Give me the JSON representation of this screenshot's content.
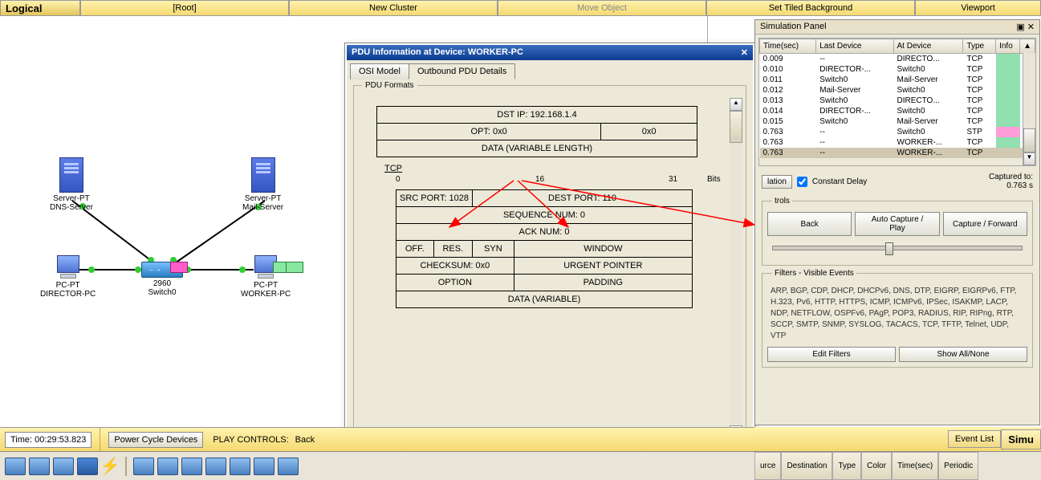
{
  "topbar": {
    "logical": "Logical",
    "root": "[Root]",
    "newCluster": "New Cluster",
    "moveObject": "Move Object",
    "tiledBg": "Set Tiled Background",
    "viewport": "Viewport"
  },
  "devices": {
    "dns": {
      "type": "Server-PT",
      "name": "DNS-Server"
    },
    "mail": {
      "type": "Server-PT",
      "name": "Mail-Server"
    },
    "director": {
      "type": "PC-PT",
      "name": "DIRECTOR-PC"
    },
    "worker": {
      "type": "PC-PT",
      "name": "WORKER-PC"
    },
    "switch": {
      "type": "2960",
      "name": "Switch0"
    }
  },
  "pdu": {
    "title": "PDU Information at Device: WORKER-PC",
    "tabs": {
      "osi": "OSI Model",
      "outbound": "Outbound PDU Details"
    },
    "formats": "PDU Formats",
    "ip": {
      "dstip": "DST IP: 192.168.1.4",
      "opt": "OPT: 0x0",
      "zero": "0x0",
      "data": "DATA (VARIABLE LENGTH)"
    },
    "tcp": {
      "label": "TCP",
      "r0": "0",
      "r16": "16",
      "r31": "31",
      "bits": "Bits",
      "srcport": "SRC PORT: 1028",
      "dstport": "DEST PORT: 110",
      "seq": "SEQUENCE NUM: 0",
      "ack": "ACK NUM: 0",
      "off": "OFF.",
      "res": "RES.",
      "syn": "SYN",
      "window": "WINDOW",
      "chk": "CHECKSUM: 0x0",
      "urg": "URGENT POINTER",
      "option": "OPTION",
      "padding": "PADDING",
      "data": "DATA (VARIABLE)"
    }
  },
  "sim": {
    "title": "Simulation Panel",
    "cols": {
      "time": "Time(sec)",
      "last": "Last Device",
      "at": "At Device",
      "type": "Type",
      "info": "Info"
    },
    "rows": [
      {
        "t": "0.009",
        "l": "--",
        "a": "DIRECTO...",
        "ty": "TCP",
        "c": "g"
      },
      {
        "t": "0.010",
        "l": "DIRECTOR-...",
        "a": "Switch0",
        "ty": "TCP",
        "c": "g"
      },
      {
        "t": "0.011",
        "l": "Switch0",
        "a": "Mail-Server",
        "ty": "TCP",
        "c": "g"
      },
      {
        "t": "0.012",
        "l": "Mail-Server",
        "a": "Switch0",
        "ty": "TCP",
        "c": "g"
      },
      {
        "t": "0.013",
        "l": "Switch0",
        "a": "DIRECTO...",
        "ty": "TCP",
        "c": "g"
      },
      {
        "t": "0.014",
        "l": "DIRECTOR-...",
        "a": "Switch0",
        "ty": "TCP",
        "c": "g"
      },
      {
        "t": "0.015",
        "l": "Switch0",
        "a": "Mail-Server",
        "ty": "TCP",
        "c": "g"
      },
      {
        "t": "0.763",
        "l": "--",
        "a": "Switch0",
        "ty": "STP",
        "c": "p"
      },
      {
        "t": "0.763",
        "l": "--",
        "a": "WORKER-...",
        "ty": "TCP",
        "c": "g"
      },
      {
        "t": "0.763",
        "l": "--",
        "a": "WORKER-...",
        "ty": "TCP",
        "c": "g",
        "sel": true
      }
    ],
    "capLabel": "Captured to:",
    "capTime": "0.763 s",
    "constDelay": "Constant Delay",
    "lation": "lation",
    "ctrls": {
      "label": "trols",
      "back": "Back",
      "auto": "Auto Capture / Play",
      "fwd": "Capture / Forward"
    },
    "filters": {
      "label": "Filters - Visible Events",
      "text": "ARP, BGP, CDP, DHCP, DHCPv6, DNS, DTP, EIGRP, EIGRPv6, FTP, H.323, Pv6, HTTP, HTTPS, ICMP, ICMPv6, IPSec, ISAKMP, LACP, NDP, NETFLOW, OSPFv6, PAgP, POP3, RADIUS, RIP, RIPng, RTP, SCCP, SMTP, SNMP, SYSLOG, TACACS, TCP, TFTP, Telnet, UDP, VTP",
      "edit": "Edit Filters",
      "show": "Show All/None"
    }
  },
  "bottom": {
    "time": "Time: 00:29:53.823",
    "power": "Power Cycle Devices",
    "playControls": "PLAY CONTROLS:",
    "back": "Back",
    "eventList": "Event List",
    "simu": "Simu"
  },
  "cols2": {
    "src": "urce",
    "dst": "Destination",
    "type": "Type",
    "color": "Color",
    "ts": "Time(sec)",
    "per": "Periodic"
  }
}
